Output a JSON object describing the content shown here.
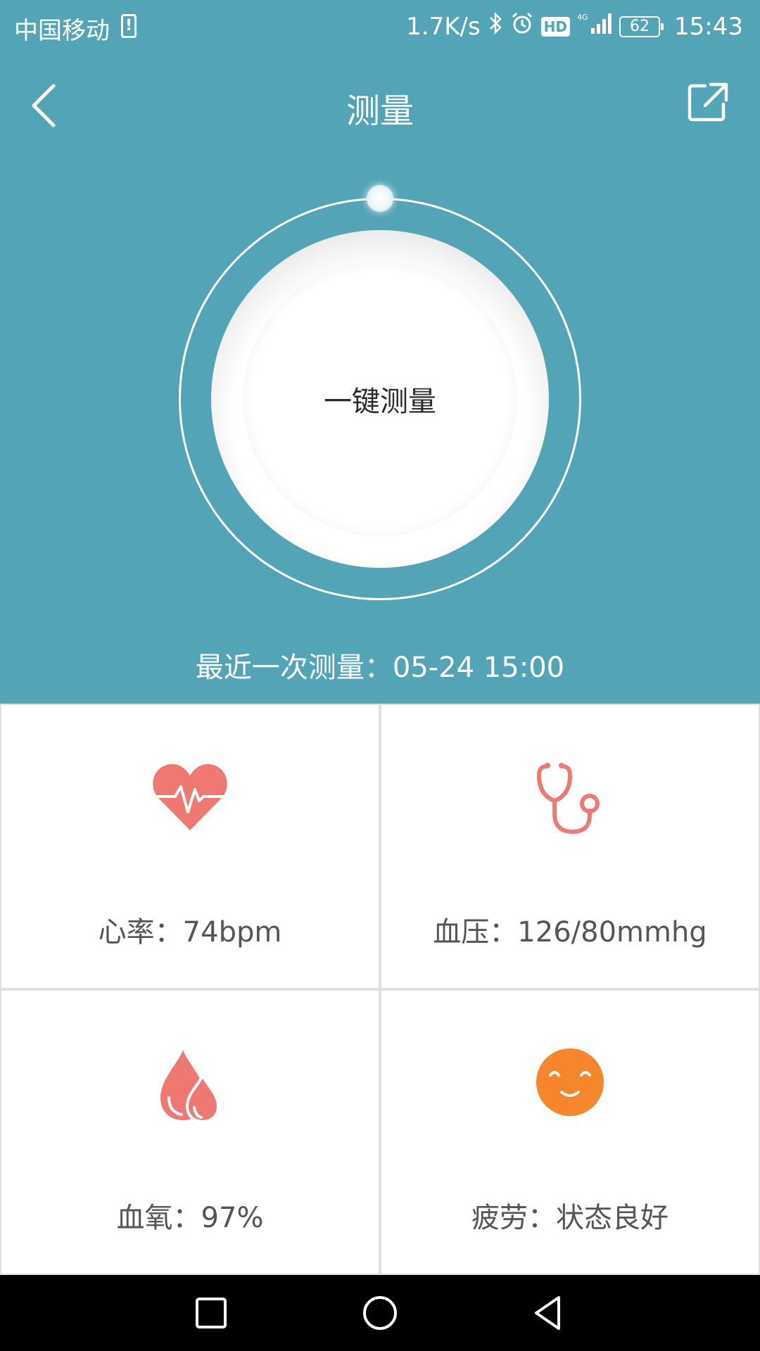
{
  "status_bar": {
    "carrier": "中国移动",
    "battery_warning": "!",
    "net_speed": "1.7K/s",
    "hd": "HD",
    "signal_type": "4G",
    "battery_level": "62",
    "time": "15:43"
  },
  "app_bar": {
    "title": "测量"
  },
  "measure": {
    "button_label": "一键测量",
    "last_measure_label": "最近一次测量：",
    "last_measure_time": "05-24 15:00"
  },
  "metrics": [
    {
      "key": "heart_rate",
      "label": "心率：",
      "value": "74bpm",
      "icon": "heart-rate-icon",
      "color": "#f07872"
    },
    {
      "key": "blood_pressure",
      "label": "血压：",
      "value": "126/80mmhg",
      "icon": "stethoscope-icon",
      "color": "#f07872"
    },
    {
      "key": "blood_oxygen",
      "label": "血氧：",
      "value": "97%",
      "icon": "blood-drops-icon",
      "color": "#f07872"
    },
    {
      "key": "fatigue",
      "label": "疲劳：",
      "value": "状态良好",
      "icon": "smiley-face-icon",
      "color": "#f5862b"
    }
  ],
  "colors": {
    "header_bg": "#53a4b6",
    "accent_red": "#f07872",
    "accent_orange": "#f5862b"
  }
}
